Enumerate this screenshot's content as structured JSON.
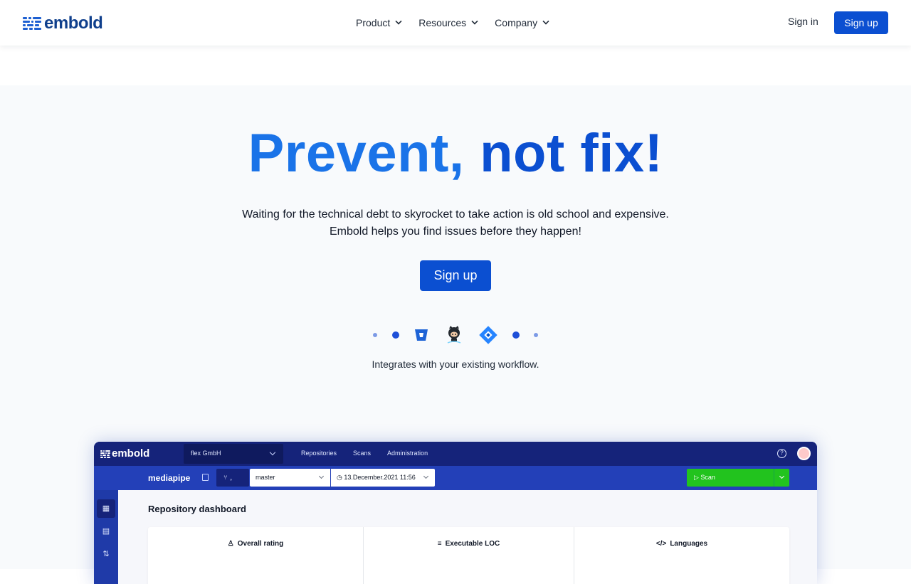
{
  "nav": {
    "logo_text": "embold",
    "menu": [
      {
        "label": "Product"
      },
      {
        "label": "Resources"
      },
      {
        "label": "Company"
      }
    ],
    "sign_in": "Sign in",
    "sign_up": "Sign up"
  },
  "hero": {
    "title_part1": "Prevent, ",
    "title_part2": "not fix!",
    "subtitle_line1": "Waiting for the technical debt to skyrocket to take action is old school and expensive.",
    "subtitle_line2": "Embold helps you find issues before they happen!",
    "cta": "Sign up",
    "integrations_label": "Integrates with your existing workflow.",
    "integration_icons": [
      "bitbucket-icon",
      "github-icon",
      "jira-icon"
    ]
  },
  "app_preview": {
    "logo_text": "embold",
    "org": "flex GmbH",
    "nav": [
      "Repositories",
      "Scans",
      "Administration"
    ],
    "repo": "mediapipe",
    "branch": "master",
    "date": "13.December.2021 11:56",
    "scan": "Scan",
    "dashboard_title": "Repository dashboard",
    "cards": [
      {
        "label": "Overall rating",
        "icon": "award-icon"
      },
      {
        "label": "Executable LOC",
        "icon": "lines-icon"
      },
      {
        "label": "Languages",
        "icon": "code-icon"
      }
    ]
  },
  "colors": {
    "brand_blue": "#0b4fd1",
    "title_blue": "#1a73e8",
    "app_navy": "#15237a",
    "scan_green": "#22c31e"
  }
}
